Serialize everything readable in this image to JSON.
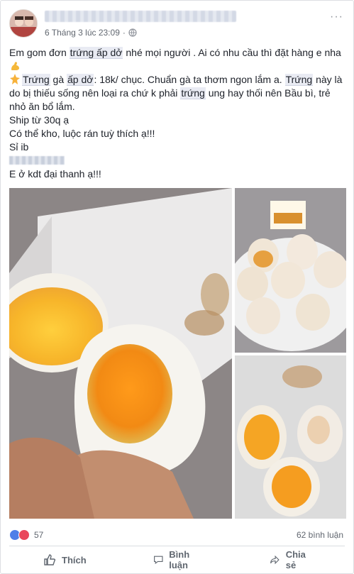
{
  "header": {
    "timestamp": "6 Tháng 3 lúc 23:09",
    "more_label": "···"
  },
  "post": {
    "line1_a": "Em gom đơn ",
    "line1_hl": "trứng ấp dở",
    "line1_b": " nhé mọi người . Ai có nhu cầu thì đặt hàng e nha",
    "line3_hl1": "Trứng",
    "line3_a": " gà ",
    "line3_hl2": "ấp dở",
    "line3_b": ": 18k/ chục. Chuẩn gà ta thơm ngon lắm a. ",
    "line3_hl3": "Trứng",
    "line3_c": " này là do bị thiếu sống nên loại ra chứ k phải ",
    "line3_hl4": "trứng",
    "line3_d": " ung hay thối nên Bầu bì, trẻ nhỏ ăn bổ lắm.",
    "line4": "Ship từ 30q ạ",
    "line5": "Có thể kho, luộc rán tuỳ thích ạ!!!",
    "line6": "Sỉ ib",
    "line8": "E ở kdt đại thanh ạ!!!"
  },
  "reactions": {
    "count": "57",
    "comments": "62 bình luận"
  },
  "actions": {
    "like": "Thích",
    "comment": "Bình luận",
    "share": "Chia sẻ"
  },
  "icons": {
    "emoji_strong": "flexed-biceps-icon",
    "emoji_star": "sparkle-star-icon",
    "globe": "globe-icon",
    "like": "thumbs-up-icon",
    "love": "heart-icon"
  },
  "colors": {
    "highlight": "#e9ebf3",
    "like_blue": "#4f7fe8",
    "love_red": "#e9475b",
    "meta_grey": "#616770"
  }
}
